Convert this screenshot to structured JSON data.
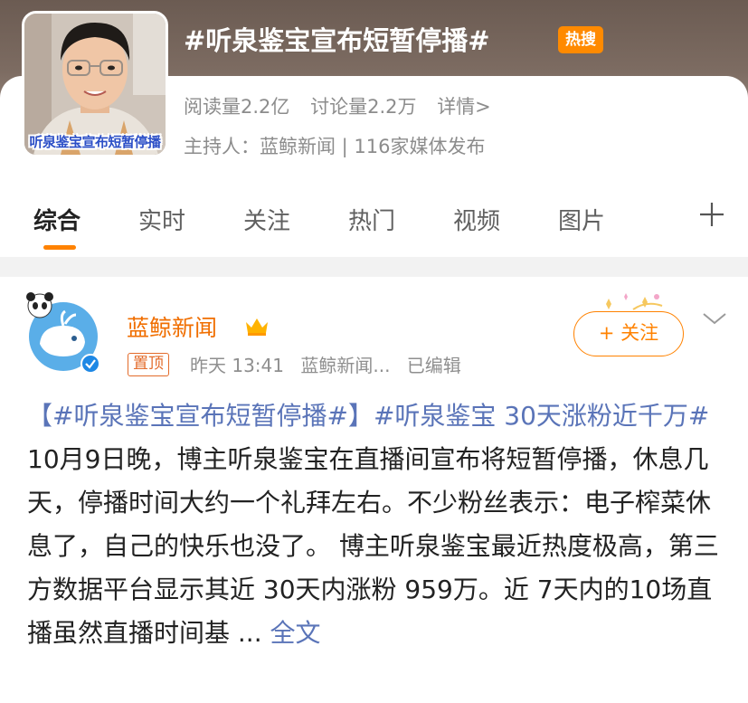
{
  "topic": {
    "title": "#听泉鉴宝宣布短暂停播#",
    "hot_badge": "热搜",
    "thumb_caption": "听泉鉴宝宣布短暂停播",
    "read_count": "阅读量2.2亿",
    "discuss_count": "讨论量2.2万",
    "detail_link": "详情>",
    "host_line": "主持人：蓝鲸新闻 | 116家媒体发布"
  },
  "tabs": [
    {
      "label": "综合",
      "active": true
    },
    {
      "label": "实时",
      "active": false
    },
    {
      "label": "关注",
      "active": false
    },
    {
      "label": "热门",
      "active": false
    },
    {
      "label": "视频",
      "active": false
    },
    {
      "label": "图片",
      "active": false
    }
  ],
  "post": {
    "author": "蓝鲸新闻",
    "pinned": "置顶",
    "time": "昨天 13:41",
    "source": "蓝鲸新闻...",
    "edited": "已编辑",
    "follow_label": "+ 关注",
    "tag1": "【#听泉鉴宝宣布短暂停播#】",
    "tag2": "#听泉鉴宝 30天涨粉近千万#",
    "text": " 10月9日晚，博主听泉鉴宝在直播间宣布将短暂停播，休息几天，停播时间大约一个礼拜左右。不少粉丝表示：电子榨菜休息了，自己的快乐也没了。 博主听泉鉴宝最近热度极高，第三方数据平台显示其近 30天内涨粉 959万。近 7天内的10场直播虽然直播时间基 ...",
    "more": " 全文"
  },
  "colors": {
    "accent": "#ff8200",
    "link": "#5a74b8",
    "author": "#f06e00",
    "hot_badge": "#ff8a00"
  }
}
